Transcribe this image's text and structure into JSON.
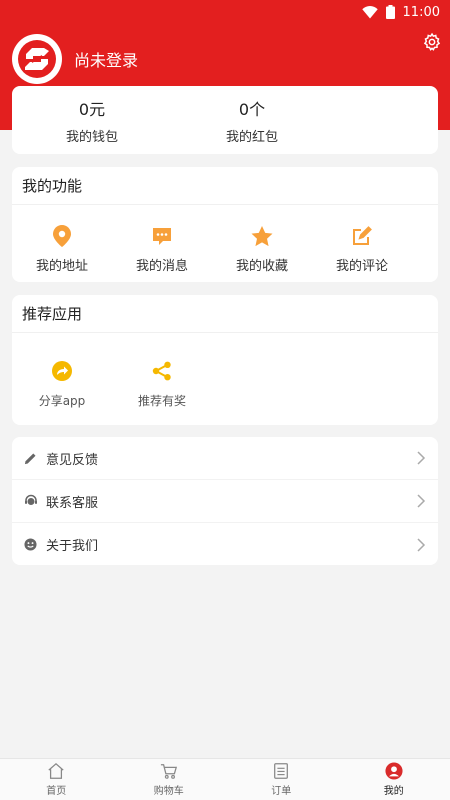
{
  "status": {
    "time": "11:00"
  },
  "profile": {
    "login_text": "尚未登录"
  },
  "wallet": [
    {
      "value": "0元",
      "label": "我的钱包"
    },
    {
      "value": "0个",
      "label": "我的红包"
    }
  ],
  "functions": {
    "title": "我的功能",
    "items": [
      {
        "label": "我的地址",
        "icon": "location-icon"
      },
      {
        "label": "我的消息",
        "icon": "message-icon"
      },
      {
        "label": "我的收藏",
        "icon": "star-icon"
      },
      {
        "label": "我的评论",
        "icon": "edit-icon"
      }
    ]
  },
  "recommend": {
    "title": "推荐应用",
    "items": [
      {
        "label": "分享app",
        "icon": "share-icon"
      },
      {
        "label": "推荐有奖",
        "icon": "share-nodes-icon"
      }
    ]
  },
  "menu": [
    {
      "label": "意见反馈",
      "icon": "pencil-icon"
    },
    {
      "label": "联系客服",
      "icon": "customer-service-icon"
    },
    {
      "label": "关于我们",
      "icon": "smile-icon"
    }
  ],
  "tabs": [
    {
      "label": "首页",
      "icon": "home-icon"
    },
    {
      "label": "购物车",
      "icon": "cart-icon"
    },
    {
      "label": "订单",
      "icon": "list-icon"
    },
    {
      "label": "我的",
      "icon": "user-icon",
      "active": true
    }
  ],
  "colors": {
    "brand": "#e31f1f",
    "orange": "#f7a03a",
    "yellow": "#f5b800",
    "white": "#ffffff"
  }
}
